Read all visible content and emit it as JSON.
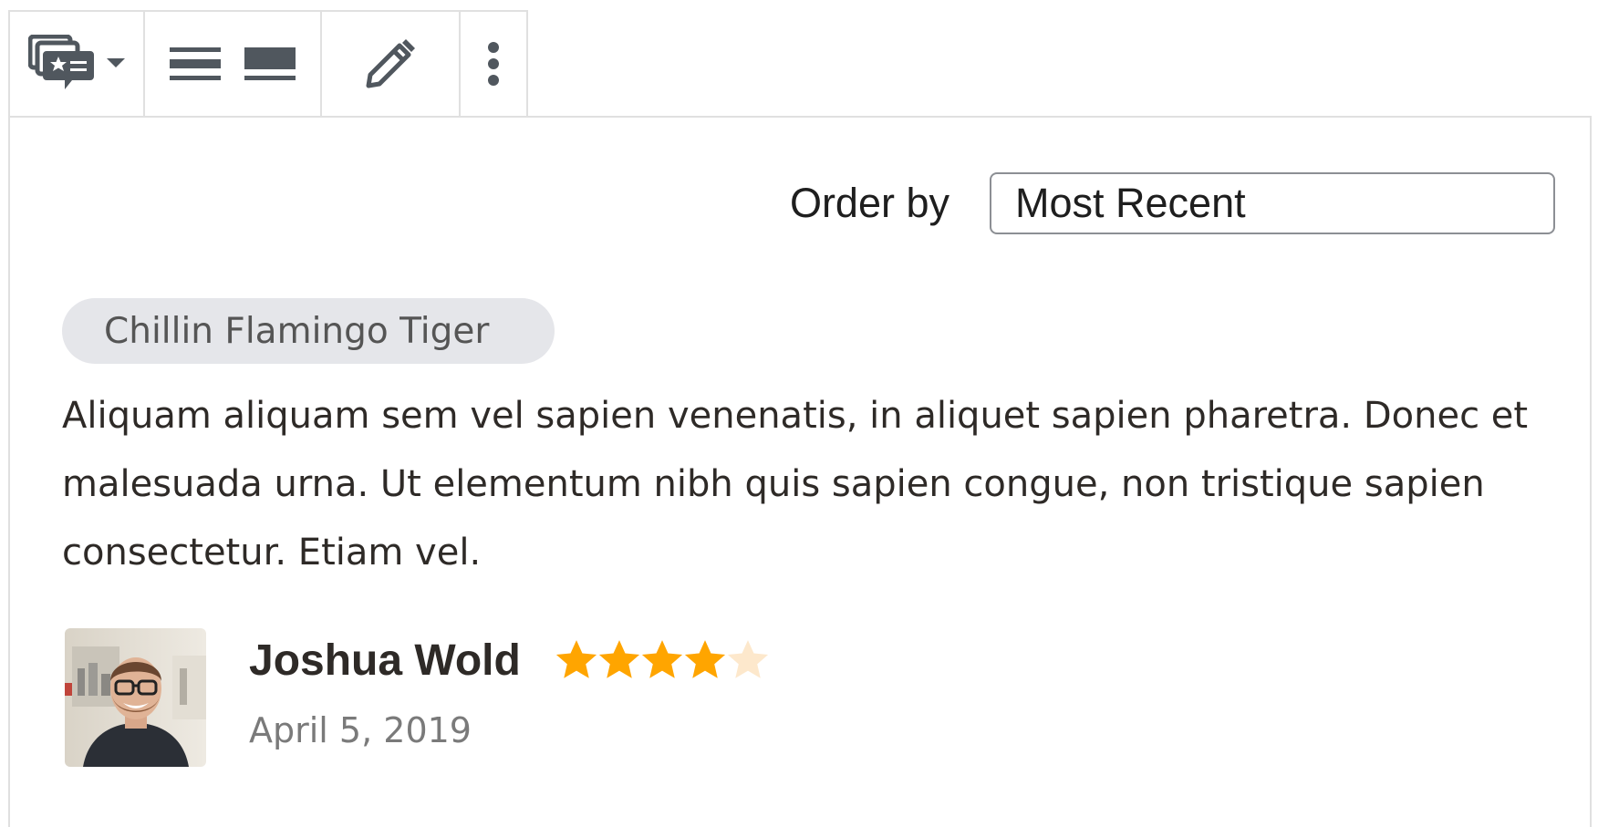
{
  "toolbar": {
    "block_type_icon": "reviews-block-icon",
    "dropdown_icon": "caret-down-icon",
    "align_wide_icon": "align-wide-icon",
    "align_full_icon": "align-full-icon",
    "edit_icon": "pencil-icon",
    "more_icon": "more-vertical-icon"
  },
  "order_by": {
    "label": "Order by",
    "selected": "Most Recent"
  },
  "review": {
    "product_tag": "Chillin Flamingo Tiger",
    "text": "Aliquam aliquam sem vel sapien venenatis, in aliquet sapien pharetra. Donec et malesuada urna. Ut elementum nibh quis sapien congue, non tristique sapien consectetur. Etiam vel.",
    "reviewer": "Joshua Wold",
    "date": "April 5, 2019",
    "rating": 4,
    "rating_max": 5
  },
  "colors": {
    "star_filled": "#ffa500",
    "star_empty": "#fde8cc",
    "icon": "#50575e",
    "tag_bg": "#e5e6ea"
  }
}
